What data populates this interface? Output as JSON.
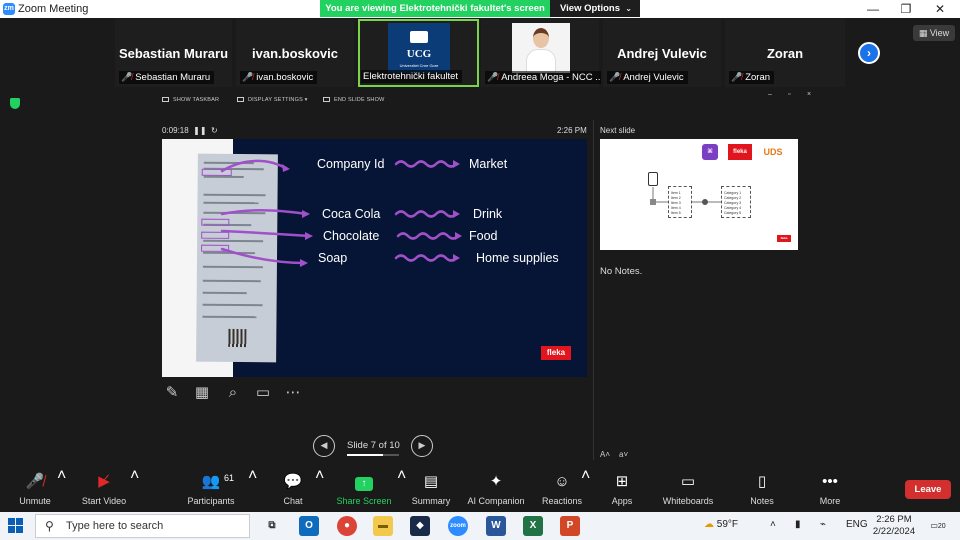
{
  "window": {
    "title": "Zoom Meeting",
    "banner": "You are viewing Elektrotehnički fakultet's screen",
    "view_options": "View Options",
    "minimize": "—",
    "restore": "❐",
    "close": "✕"
  },
  "participants": [
    {
      "big_name": "Sebastian Muraru",
      "label": "Sebastian Muraru"
    },
    {
      "big_name": "ivan.boskovic",
      "label": "ivan.boskovic"
    },
    {
      "big_name": "",
      "label": "Elektrotehnički fakultet",
      "logo_text": "UCG",
      "logo_sub": "Univerzitet Crne Gore"
    },
    {
      "big_name": "",
      "label": "Andreea Moga - NCC ..."
    },
    {
      "big_name": "Andrej Vulevic",
      "label": "Andrej Vulevic"
    },
    {
      "big_name": "Zoran",
      "label": "Zoran"
    }
  ],
  "view_button": "View",
  "presenter": {
    "toolbar": [
      "SHOW TASKBAR",
      "DISPLAY SETTINGS ▾",
      "END SLIDE SHOW"
    ],
    "timer": "0:09:18",
    "clock": "2:26 PM",
    "next_slide_label": "Next slide",
    "no_notes": "No Notes.",
    "slide_counter": "Slide 7 of 10",
    "slide_progress": 0.7
  },
  "slide": {
    "rows": [
      {
        "left": "Company Id",
        "right": "Market"
      },
      {
        "left": "Coca Cola",
        "right": "Drink"
      },
      {
        "left": "Chocolate",
        "right": "Food"
      },
      {
        "left": "Soap",
        "right": "Home supplies"
      }
    ],
    "logo": "fleka"
  },
  "next_slide": {
    "logos": [
      "fleka",
      "UDS"
    ],
    "items": [
      "Item 1",
      "Item 2",
      "Item 3",
      "Item 4",
      "Item 5"
    ],
    "categories": [
      "Category 1",
      "Category 2",
      "Category 3",
      "Category 4",
      "Category 5"
    ],
    "footer_logo": "fleka"
  },
  "controls": {
    "unmute": "Unmute",
    "start_video": "Start Video",
    "participants": "Participants",
    "participant_count": "61",
    "chat": "Chat",
    "share_screen": "Share Screen",
    "summary": "Summary",
    "ai_companion": "AI Companion",
    "reactions": "Reactions",
    "apps": "Apps",
    "whiteboards": "Whiteboards",
    "notes": "Notes",
    "more": "More",
    "leave": "Leave"
  },
  "taskbar": {
    "search_placeholder": "Type here to search",
    "weather": "59°F",
    "language": "ENG",
    "time": "2:26 PM",
    "date": "2/22/2024",
    "notifications": "20"
  },
  "colors": {
    "zoom_green": "#23d160",
    "leave_red": "#d32f2f",
    "slide_bg": "#061536",
    "arrow_purple": "#a050c8"
  }
}
